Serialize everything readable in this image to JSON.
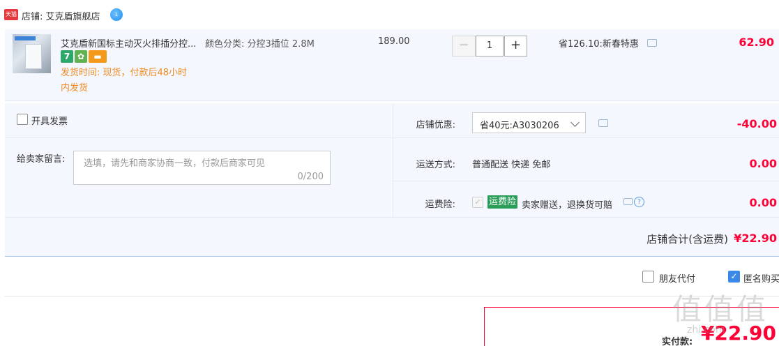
{
  "shop": {
    "logo_text": "天猫",
    "label": "店铺: 艾克盾旗舰店",
    "contact_badge": "1"
  },
  "item": {
    "title": "艾克盾新国标主动灭火排插分控...",
    "sku": "颜色分类: 分控3插位 2.8M",
    "badges": [
      "7",
      "✿",
      "▬"
    ],
    "shipping_line1": "发货时间: 现货，付款后48小时",
    "shipping_line2": "内发货",
    "unit_price": "189.00",
    "qty_minus": "−",
    "quantity": "1",
    "qty_plus": "+",
    "promo": "省126.10:新春特惠",
    "total": "62.90"
  },
  "options": {
    "invoice_label": "开具发票",
    "message_label": "给卖家留言:",
    "message_placeholder": "选填，请先和商家协商一致，付款后商家可见",
    "message_counter": "0/200",
    "coupon_label": "店铺优惠:",
    "coupon_value": "省40元:A3030206",
    "coupon_amount": "-40.00",
    "shipping_label": "运送方式:",
    "shipping_value": "普通配送 快递 免邮",
    "shipping_amount": "0.00",
    "insurance_label": "运费险:",
    "insurance_tag": "运费险",
    "insurance_desc": "卖家赠送，退换货可赔",
    "insurance_help": "?",
    "insurance_amount": "0.00",
    "subtotal_label": "店铺合计(含运费)",
    "subtotal_value": "¥22.90"
  },
  "extras": {
    "friend_pay_label": "朋友代付",
    "anonymous_label": "匿名购买",
    "anonymous_checked_glyph": "✓"
  },
  "payment": {
    "label": "实付款:",
    "value": "¥22.90"
  },
  "watermark": {
    "text": "值值值",
    "url": "zhi.com"
  },
  "colors": {
    "accent_red": "#ff0036",
    "panel_bg": "#f4f8fe",
    "shipping_orange": "#f08a24",
    "insurance_green": "#2a9d59",
    "checkbox_blue": "#3b88e8"
  }
}
